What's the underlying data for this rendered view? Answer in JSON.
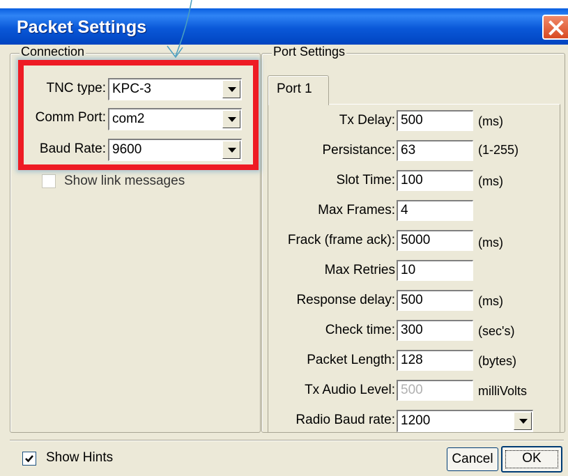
{
  "window": {
    "title": "Packet Settings",
    "colors": {
      "title_bar": "#0a58d8",
      "close_button": "#d84a22",
      "highlight": "#ee1b24",
      "face": "#ece9d8"
    }
  },
  "connection": {
    "legend": "Connection",
    "tnc_type": {
      "label": "TNC type:",
      "value": "KPC-3"
    },
    "comm_port": {
      "label": "Comm Port:",
      "value": "com2"
    },
    "baud_rate": {
      "label": "Baud Rate:",
      "value": "9600"
    },
    "show_link_messages": {
      "label": "Show link messages",
      "checked": false
    }
  },
  "port_settings": {
    "legend": "Port Settings",
    "tab_label": "Port 1",
    "fields": {
      "tx_delay": {
        "label": "Tx Delay:",
        "value": "500",
        "unit": "(ms)"
      },
      "persistance": {
        "label": "Persistance:",
        "value": "63",
        "unit": "(1-255)"
      },
      "slot_time": {
        "label": "Slot Time:",
        "value": "100",
        "unit": "(ms)"
      },
      "max_frames": {
        "label": "Max Frames:",
        "value": "4",
        "unit": ""
      },
      "frack": {
        "label": "Frack (frame ack):",
        "value": "5000",
        "unit": "(ms)"
      },
      "max_retries": {
        "label": "Max Retries",
        "value": "10",
        "unit": ""
      },
      "response_delay": {
        "label": "Response delay:",
        "value": "500",
        "unit": "(ms)"
      },
      "check_time": {
        "label": "Check time:",
        "value": "300",
        "unit": "(sec's)"
      },
      "packet_length": {
        "label": "Packet Length:",
        "value": "128",
        "unit": "(bytes)"
      },
      "tx_audio_level": {
        "label": "Tx Audio Level:",
        "value": "500",
        "unit": "milliVolts"
      }
    },
    "radio_baud_rate": {
      "label": "Radio Baud rate:",
      "value": "1200"
    }
  },
  "footer": {
    "show_hints": {
      "label": "Show Hints",
      "checked": true
    },
    "cancel_label": "Cancel",
    "ok_label": "OK"
  }
}
